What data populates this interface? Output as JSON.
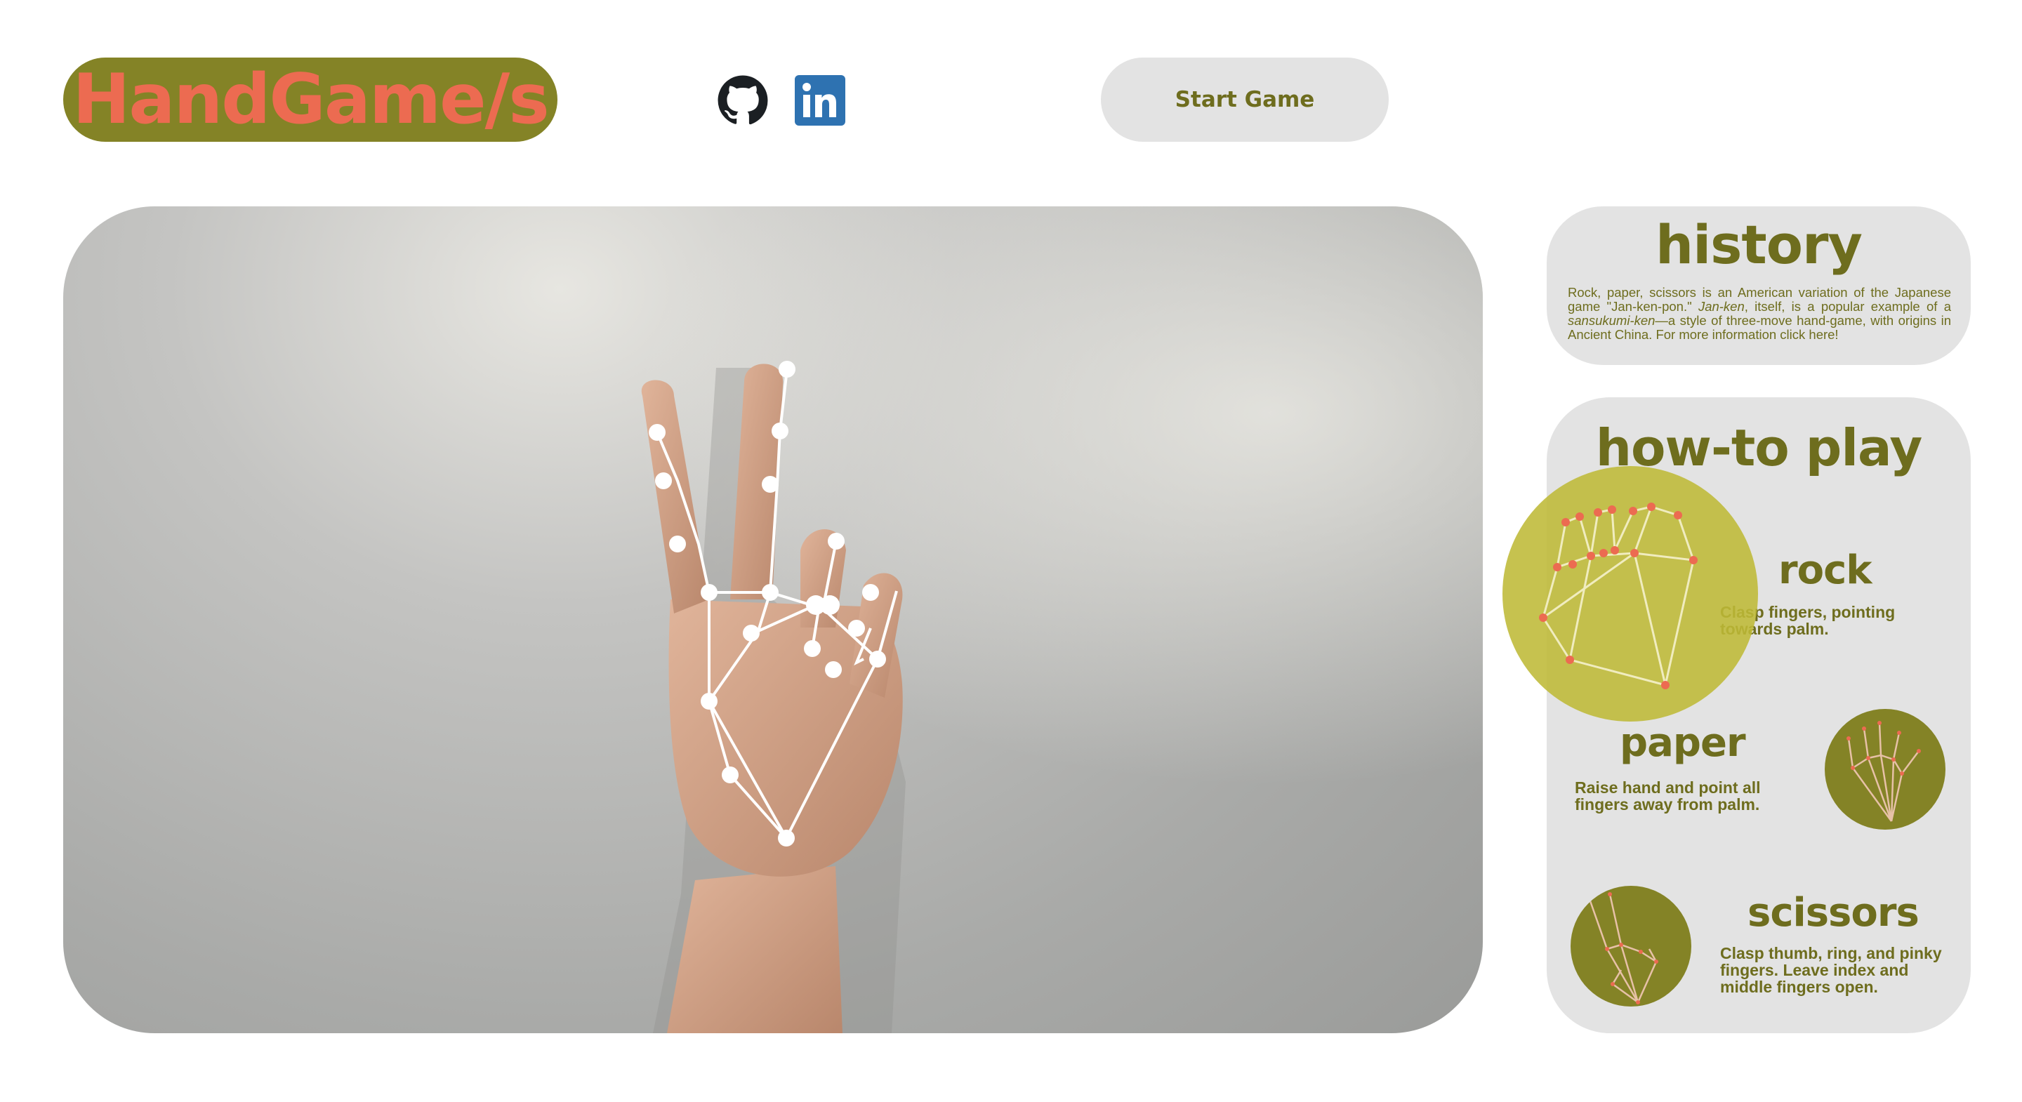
{
  "header": {
    "logo_text": "HandGame/s",
    "start_button_label": "Start Game",
    "github_icon": "github-icon",
    "linkedin_icon": "linkedin-icon",
    "linkedin_text": "in"
  },
  "history": {
    "title": "history",
    "body_1": "Rock, paper, scissors is an American variation of the Japanese game \"Jan-ken-pon.\" ",
    "body_em_1": "Jan-ken",
    "body_2": ", itself, is a popular example of a ",
    "body_em_2": "sansukumi-ken",
    "body_3": "—a style of three-move hand-game, with origins in Ancient China. For more information click here!"
  },
  "howto": {
    "title": "how-to play",
    "moves": [
      {
        "name": "rock",
        "description": "Clasp fingers, pointing towards palm."
      },
      {
        "name": "paper",
        "description": "Raise hand and point all fingers away from palm."
      },
      {
        "name": "scissors",
        "description": "Clasp thumb, ring, and pinky fingers. Leave index and middle fingers open."
      }
    ]
  },
  "colors": {
    "olive": "#848326",
    "olive_dark": "#6e6d1e",
    "coral": "#ec6b51",
    "card_gray": "#e3e3e3",
    "highlight": "#c5c24f"
  }
}
